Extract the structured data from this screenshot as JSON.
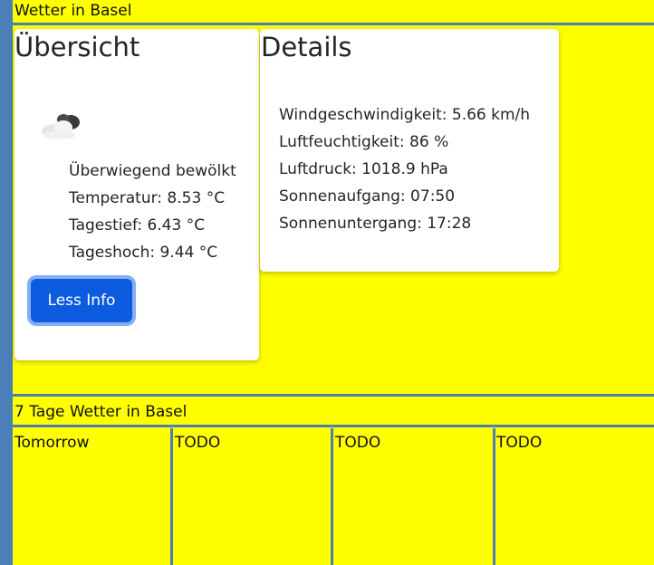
{
  "header": {
    "title": "Wetter in Basel"
  },
  "overview": {
    "heading": "Übersicht",
    "icon": "cloud-icon",
    "condition": "Überwiegend bewölkt",
    "temperature": "Temperatur: 8.53 °C",
    "min": "Tagestief: 6.43 °C",
    "max": "Tageshoch: 9.44 °C",
    "button_label": "Less Info"
  },
  "details": {
    "heading": "Details",
    "wind": "Windgeschwindigkeit: 5.66 km/h",
    "humidity": "Luftfeuchtigkeit: 86 %",
    "pressure": "Luftdruck: 1018.9 hPa",
    "sunrise": "Sonnenaufgang: 07:50",
    "sunset": "Sonnenuntergang: 17:28"
  },
  "forecast": {
    "title": "7 Tage Wetter in Basel",
    "days": [
      "Tomorrow",
      "TODO",
      "TODO",
      "TODO"
    ]
  },
  "colors": {
    "background": "#ffff00",
    "border": "#4a7fb8",
    "button": "#0d5ce0"
  }
}
